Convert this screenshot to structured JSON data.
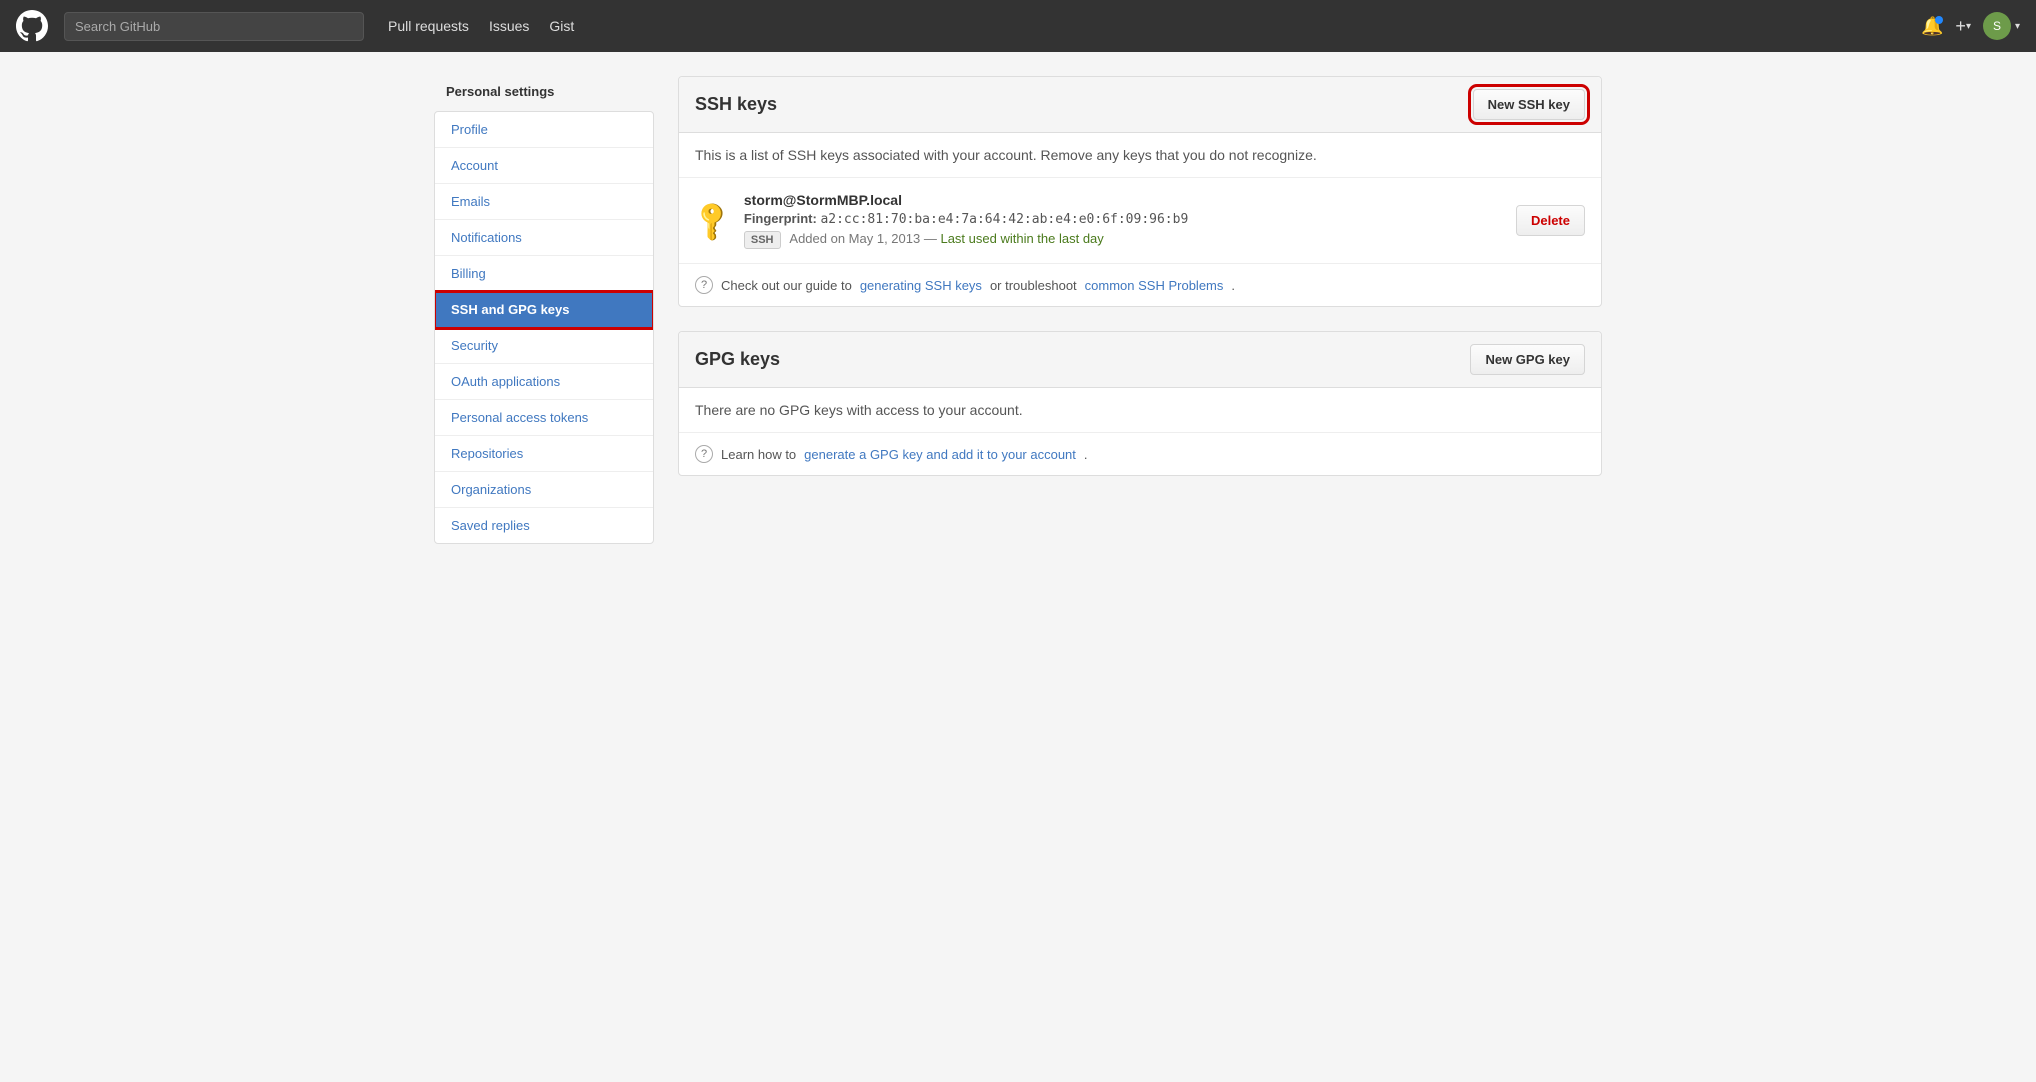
{
  "header": {
    "search_placeholder": "Search GitHub",
    "nav": [
      {
        "label": "Pull requests",
        "href": "#"
      },
      {
        "label": "Issues",
        "href": "#"
      },
      {
        "label": "Gist",
        "href": "#"
      }
    ],
    "logo_title": "GitHub",
    "add_label": "+",
    "avatar_initial": "S"
  },
  "sidebar": {
    "title": "Personal settings",
    "items": [
      {
        "id": "profile",
        "label": "Profile",
        "active": false
      },
      {
        "id": "account",
        "label": "Account",
        "active": false
      },
      {
        "id": "emails",
        "label": "Emails",
        "active": false
      },
      {
        "id": "notifications",
        "label": "Notifications",
        "active": false
      },
      {
        "id": "billing",
        "label": "Billing",
        "active": false
      },
      {
        "id": "ssh-gpg-keys",
        "label": "SSH and GPG keys",
        "active": true
      },
      {
        "id": "security",
        "label": "Security",
        "active": false
      },
      {
        "id": "oauth-applications",
        "label": "OAuth applications",
        "active": false
      },
      {
        "id": "personal-access-tokens",
        "label": "Personal access tokens",
        "active": false
      },
      {
        "id": "repositories",
        "label": "Repositories",
        "active": false
      },
      {
        "id": "organizations",
        "label": "Organizations",
        "active": false
      },
      {
        "id": "saved-replies",
        "label": "Saved replies",
        "active": false
      }
    ]
  },
  "ssh_section": {
    "title": "SSH keys",
    "new_button_label": "New SSH key",
    "description": "This is a list of SSH keys associated with your account. Remove any keys that you do not recognize.",
    "keys": [
      {
        "name": "storm@StormMBP.local",
        "fingerprint_label": "Fingerprint:",
        "fingerprint": "a2:cc:81:70:ba:e4:7a:64:42:ab:e4:e0:6f:09:96:b9",
        "added": "Added on May 1, 2013 —",
        "last_used_label": "Last used within the last day",
        "badge": "SSH",
        "delete_label": "Delete"
      }
    ],
    "help_text_prefix": "Check out our guide to",
    "help_link1_label": "generating SSH keys",
    "help_text_middle": "or troubleshoot",
    "help_link2_label": "common SSH Problems",
    "help_text_suffix": "."
  },
  "gpg_section": {
    "title": "GPG keys",
    "new_button_label": "New GPG key",
    "empty_text": "There are no GPG keys with access to your account.",
    "help_text_prefix": "Learn how to",
    "help_link_label": "generate a GPG key and add it to your account",
    "help_text_suffix": "."
  }
}
